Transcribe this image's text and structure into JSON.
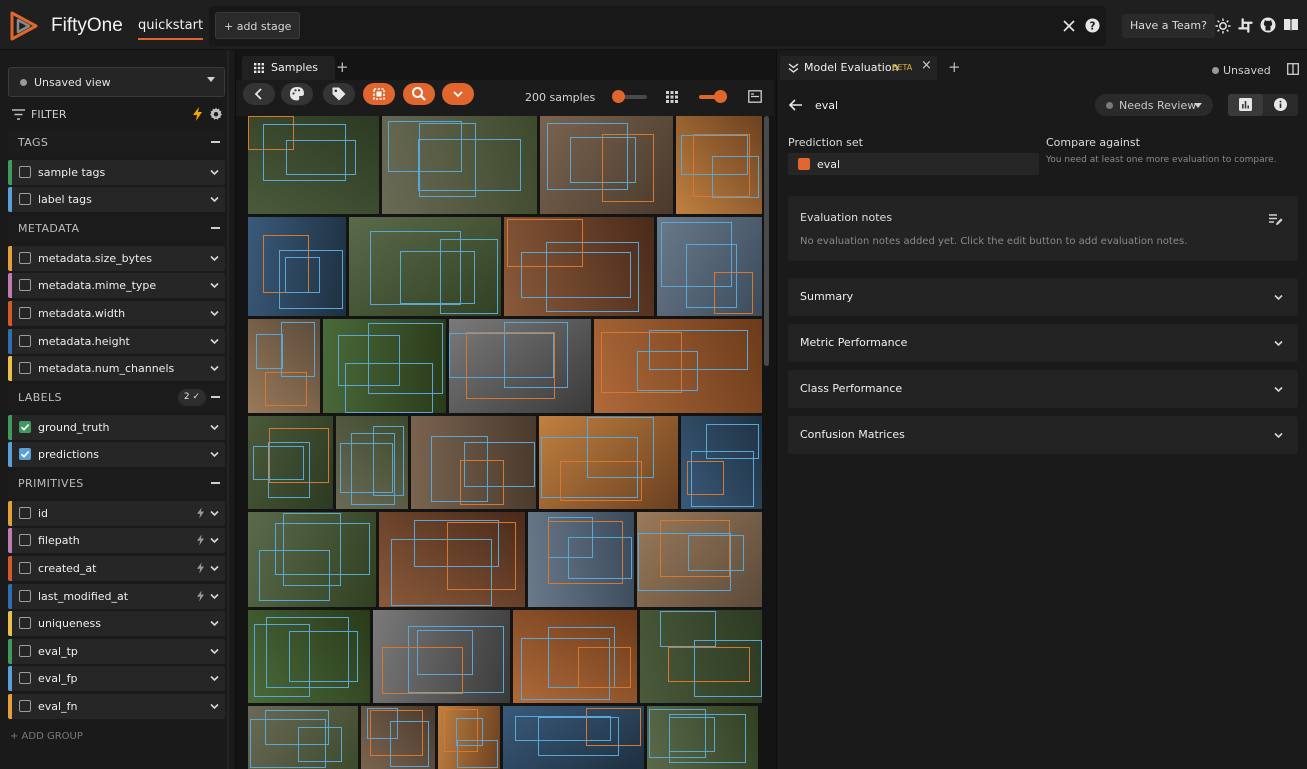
{
  "header": {
    "brand": "FiftyOne",
    "dataset": "quickstart",
    "add_stage": "+ add stage",
    "team_button": "Have a Team?"
  },
  "sidebar": {
    "view_select": "Unsaved view",
    "filter_label": "FILTER",
    "sections": {
      "tags": "TAGS",
      "metadata": "METADATA",
      "labels": "LABELS",
      "labels_badge": "2 ✓",
      "primitives": "PRIMITIVES"
    },
    "fields": [
      {
        "label": "sample tags",
        "color": "#3e9b5d",
        "checked": false,
        "bolt": false
      },
      {
        "label": "label tags",
        "color": "#5aa0d6",
        "checked": false,
        "bolt": false
      },
      {
        "label": "metadata.size_bytes",
        "color": "#e3a13a",
        "checked": false,
        "bolt": false
      },
      {
        "label": "metadata.mime_type",
        "color": "#c07cb0",
        "checked": false,
        "bolt": false
      },
      {
        "label": "metadata.width",
        "color": "#d55a2a",
        "checked": false,
        "bolt": false
      },
      {
        "label": "metadata.height",
        "color": "#2f6fb0",
        "checked": false,
        "bolt": false
      },
      {
        "label": "metadata.num_channels",
        "color": "#e8c04a",
        "checked": false,
        "bolt": false
      },
      {
        "label": "ground_truth",
        "color": "#3e9b5d",
        "checked": true,
        "bolt": false
      },
      {
        "label": "predictions",
        "color": "#5aa0d6",
        "checked": true,
        "bolt": false
      },
      {
        "label": "id",
        "color": "#e3a13a",
        "checked": false,
        "bolt": true
      },
      {
        "label": "filepath",
        "color": "#c07cb0",
        "checked": false,
        "bolt": true
      },
      {
        "label": "created_at",
        "color": "#d55a2a",
        "checked": false,
        "bolt": true
      },
      {
        "label": "last_modified_at",
        "color": "#2f6fb0",
        "checked": false,
        "bolt": true
      },
      {
        "label": "uniqueness",
        "color": "#e8c04a",
        "checked": false,
        "bolt": false
      },
      {
        "label": "eval_tp",
        "color": "#3e9b5d",
        "checked": false,
        "bolt": false
      },
      {
        "label": "eval_fp",
        "color": "#5aa0d6",
        "checked": false,
        "bolt": false
      },
      {
        "label": "eval_fn",
        "color": "#e3a13a",
        "checked": false,
        "bolt": false
      }
    ],
    "add_group": "+ ADD GROUP"
  },
  "samples": {
    "tab_label": "Samples",
    "count": "200 samples"
  },
  "panel": {
    "tab_label": "Model Evaluation",
    "beta": "BETA",
    "unsaved": "Unsaved",
    "eval_name": "eval",
    "review_status": "Needs Review",
    "prediction_set_label": "Prediction set",
    "prediction_set_value": "eval",
    "compare_label": "Compare against",
    "compare_hint": "You need at least one more evaluation to compare.",
    "notes_title": "Evaluation notes",
    "notes_empty": "No evaluation notes added yet. Click the edit button to add evaluation notes.",
    "sections": [
      "Summary",
      "Metric Performance",
      "Class Performance",
      "Confusion Matrices"
    ]
  },
  "colors": {
    "accent": "#e0662d",
    "box": "#5aa7d6",
    "beta": "#e0b536"
  }
}
